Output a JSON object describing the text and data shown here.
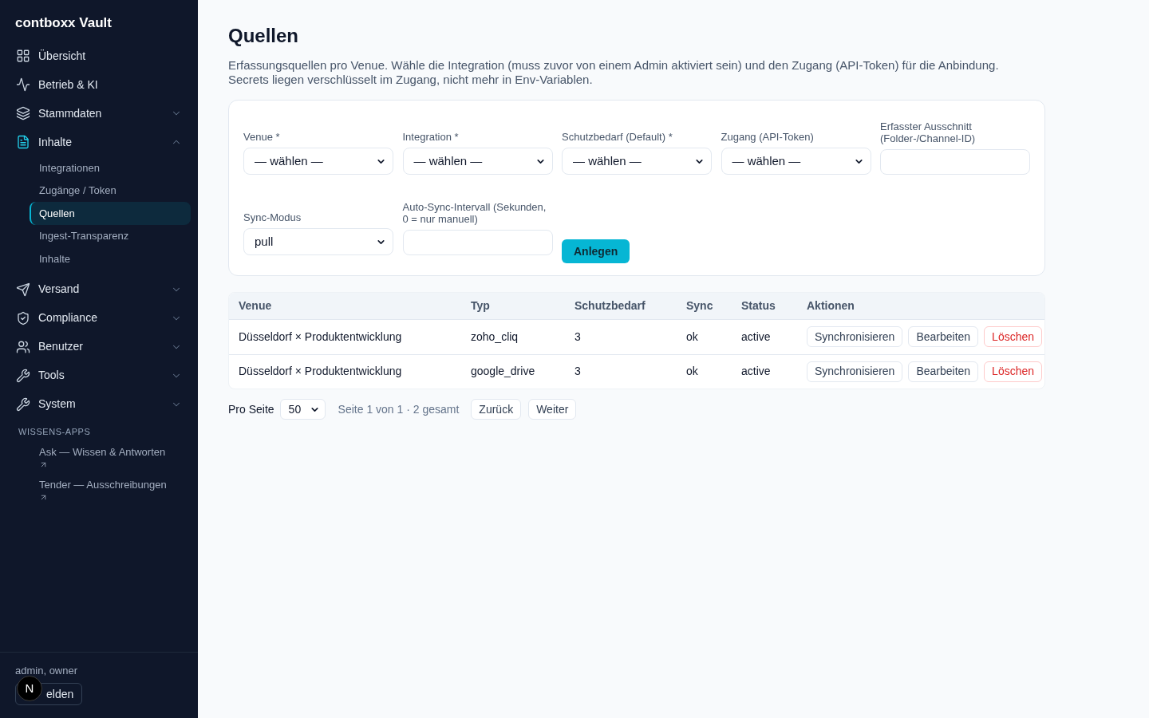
{
  "sidebar": {
    "brand": "contboxx Vault",
    "nav": [
      {
        "label": "Übersicht",
        "kind": "link",
        "selected": false
      },
      {
        "label": "Betrieb & KI",
        "kind": "link",
        "selected": false
      },
      {
        "label": "Stammdaten",
        "kind": "group",
        "selected": false,
        "expanded": false
      },
      {
        "label": "Inhalte",
        "kind": "group",
        "selected": true,
        "expanded": true,
        "children": [
          {
            "label": "Integrationen",
            "selected": false
          },
          {
            "label": "Zugänge / Token",
            "selected": false
          },
          {
            "label": "Quellen",
            "selected": true
          },
          {
            "label": "Ingest-Transparenz",
            "selected": false
          },
          {
            "label": "Inhalte",
            "selected": false
          }
        ]
      },
      {
        "label": "Versand",
        "kind": "group",
        "selected": false,
        "expanded": false
      },
      {
        "label": "Compliance",
        "kind": "group",
        "selected": false,
        "expanded": false
      },
      {
        "label": "Benutzer",
        "kind": "group",
        "selected": false,
        "expanded": false
      },
      {
        "label": "Tools",
        "kind": "group",
        "selected": false,
        "expanded": false
      },
      {
        "label": "System",
        "kind": "group",
        "selected": false,
        "expanded": false
      }
    ],
    "apps_section": {
      "heading": "WISSENS-APPS",
      "links": [
        "Ask — Wissen & Antworten",
        "Tender — Ausschreibungen"
      ]
    },
    "user": {
      "roles": "admin, owner",
      "logout_button": "elden"
    },
    "overlay_badge": "N"
  },
  "page": {
    "title": "Quellen",
    "description": "Erfassungsquellen pro Venue. Wähle die Integration (muss zuvor von einem Admin aktiviert sein) und den Zugang (API-Token) für die Anbindung. Secrets liegen verschlüsselt im Zugang, nicht mehr in Env-Variablen."
  },
  "form": {
    "fields": [
      {
        "label": "Venue *",
        "kind": "select",
        "value": "— wählen —"
      },
      {
        "label": "Integration *",
        "kind": "select",
        "value": "— wählen —"
      },
      {
        "label": "Schutzbedarf (Default) *",
        "kind": "select",
        "value": "— wählen —"
      },
      {
        "label": "Zugang (API-Token)",
        "kind": "select",
        "value": "— wählen —"
      },
      {
        "label": "Erfasster Ausschnitt (Folder-/Channel-ID)",
        "kind": "input"
      },
      {
        "label": "Sync-Modus",
        "kind": "select",
        "value": "pull"
      },
      {
        "label": "Auto-Sync-Intervall (Sekunden, 0 = nur manuell)",
        "kind": "input"
      }
    ],
    "submit": "Anlegen"
  },
  "table": {
    "columns": [
      "Venue",
      "Typ",
      "Schutzbedarf",
      "Sync",
      "Status",
      "Aktionen"
    ],
    "rows": [
      {
        "venue": "Düsseldorf × Produktentwicklung",
        "typ": "zoho_cliq",
        "schutzbedarf": "3",
        "sync": "ok",
        "status": "active",
        "actions": [
          {
            "label": "Synchronisieren",
            "kind": "default"
          },
          {
            "label": "Bearbeiten",
            "kind": "default"
          },
          {
            "label": "Löschen",
            "kind": "danger"
          }
        ]
      },
      {
        "venue": "Düsseldorf × Produktentwicklung",
        "typ": "google_drive",
        "schutzbedarf": "3",
        "sync": "ok",
        "status": "active",
        "actions": [
          {
            "label": "Synchronisieren",
            "kind": "default"
          },
          {
            "label": "Bearbeiten",
            "kind": "default"
          },
          {
            "label": "Löschen",
            "kind": "danger"
          }
        ]
      }
    ]
  },
  "pagination": {
    "label": "Pro Seite",
    "page_size": "50",
    "info": "Seite 1 von 1 · 2 gesamt",
    "buttons": [
      "Zurück",
      "Weiter"
    ]
  }
}
